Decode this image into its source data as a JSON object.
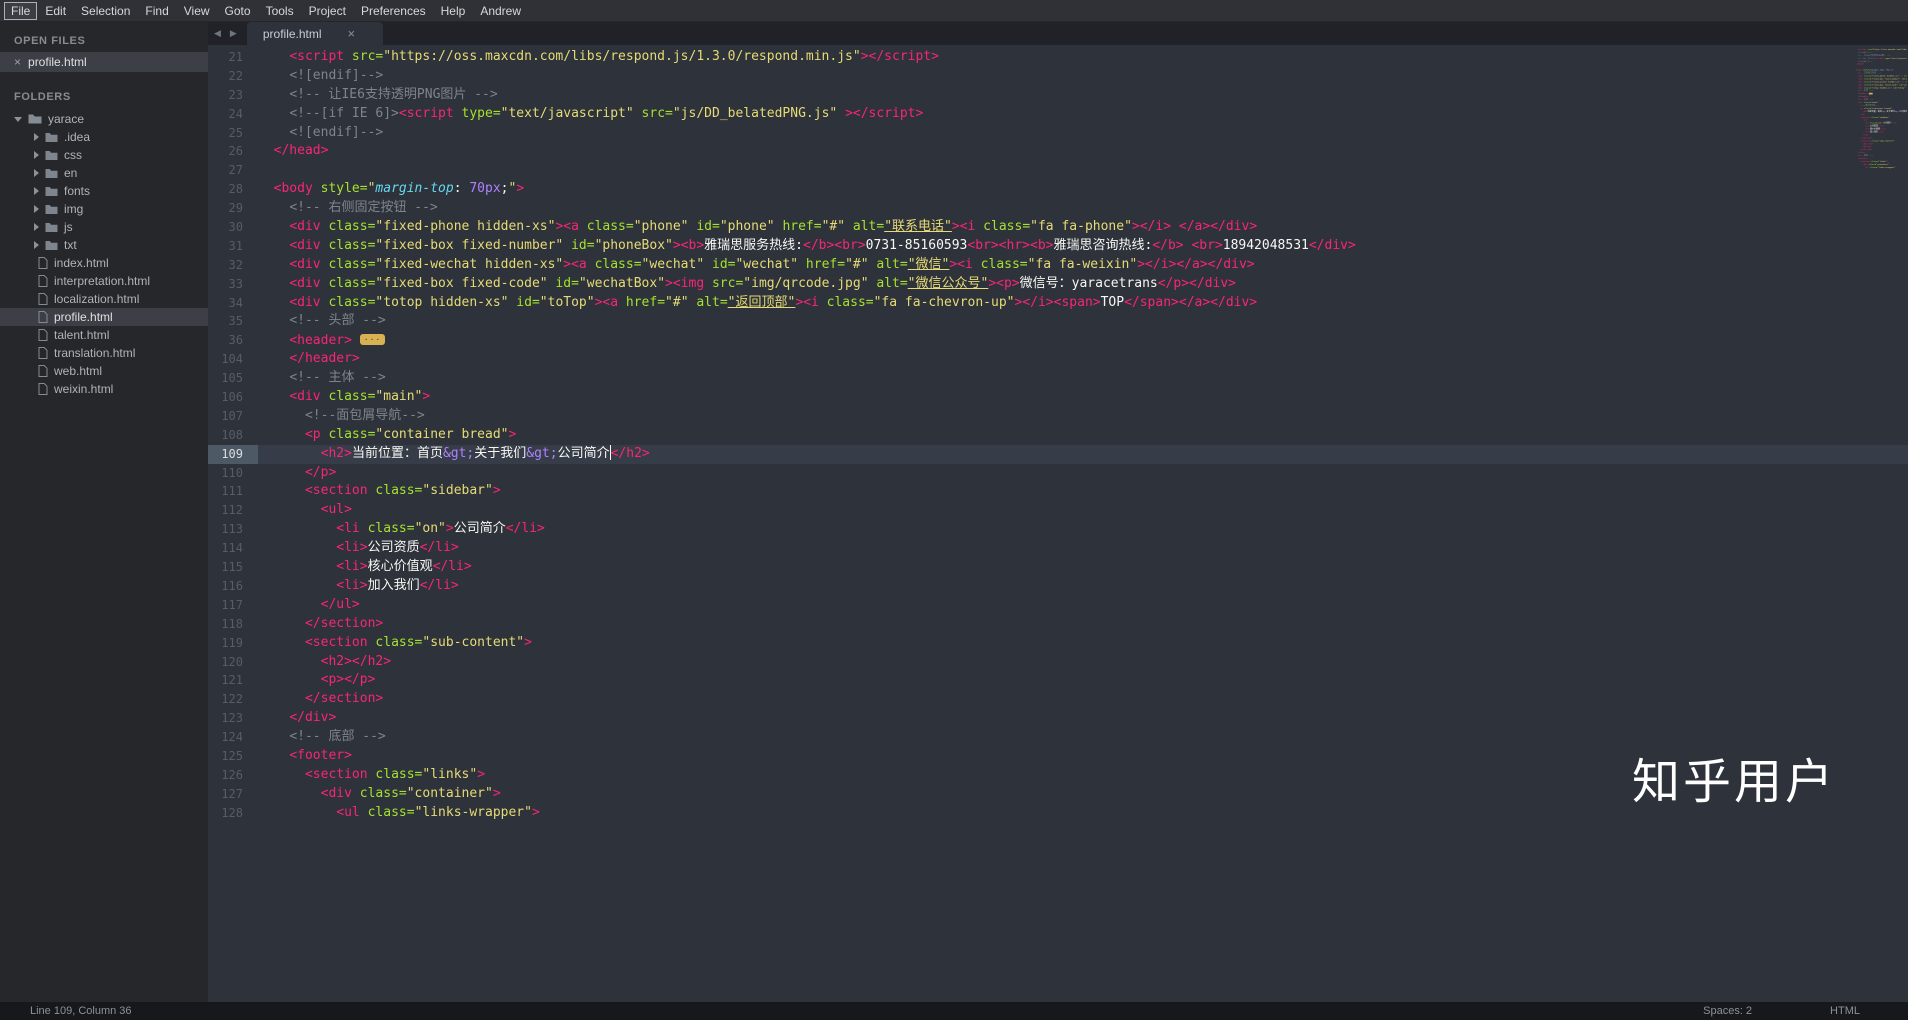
{
  "menu": {
    "items": [
      "File",
      "Edit",
      "Selection",
      "Find",
      "View",
      "Goto",
      "Tools",
      "Project",
      "Preferences",
      "Help",
      "Andrew"
    ],
    "active_item": "File"
  },
  "sidebar": {
    "open_files_label": "OPEN FILES",
    "close_icon": "×",
    "open_files": [
      {
        "name": "profile.html",
        "selected": true
      }
    ],
    "folders_label": "FOLDERS",
    "tree": {
      "root": "yarace",
      "folders": [
        ".idea",
        "css",
        "en",
        "fonts",
        "img",
        "js",
        "txt"
      ],
      "files": [
        "index.html",
        "interpretation.html",
        "localization.html",
        "profile.html",
        "talent.html",
        "translation.html",
        "web.html",
        "weixin.html"
      ],
      "selected_file": "profile.html"
    }
  },
  "tabbar": {
    "back_icon": "◀",
    "forward_icon": "▶",
    "tabs": [
      {
        "title": "profile.html",
        "active": true,
        "close_icon": "×"
      }
    ]
  },
  "editor": {
    "cursor_line": 109,
    "lines": [
      {
        "n": 21,
        "t": [
          [
            "w",
            "    "
          ],
          [
            "t",
            "<script"
          ],
          [
            "a",
            " src="
          ],
          [
            "s",
            "\"https://oss.maxcdn.com/libs/respond.js/1.3.0/respond.min.js\""
          ],
          [
            "t",
            "></script>"
          ]
        ]
      },
      {
        "n": 22,
        "t": [
          [
            "w",
            "    "
          ],
          [
            "c",
            "<![endif]-->"
          ]
        ]
      },
      {
        "n": 23,
        "t": [
          [
            "w",
            "    "
          ],
          [
            "c",
            "<!-- 让IE6支持透明PNG图片 -->"
          ]
        ]
      },
      {
        "n": 24,
        "t": [
          [
            "w",
            "    "
          ],
          [
            "c",
            "<!--[if IE 6]>"
          ],
          [
            "t",
            "<script"
          ],
          [
            "a",
            " type="
          ],
          [
            "s",
            "\"text/javascript\""
          ],
          [
            "a",
            " src="
          ],
          [
            "s",
            "\"js/DD_belatedPNG.js\""
          ],
          [
            "w",
            " "
          ],
          [
            "t",
            "></script>"
          ]
        ]
      },
      {
        "n": 25,
        "t": [
          [
            "w",
            "    "
          ],
          [
            "c",
            "<![endif]-->"
          ]
        ]
      },
      {
        "n": 26,
        "t": [
          [
            "w",
            "  "
          ],
          [
            "t",
            "</head>"
          ]
        ]
      },
      {
        "n": 27,
        "t": []
      },
      {
        "n": 28,
        "t": [
          [
            "w",
            "  "
          ],
          [
            "t",
            "<body"
          ],
          [
            "a",
            " style="
          ],
          [
            "s",
            "\""
          ],
          [
            "i",
            "margin-top"
          ],
          [
            "w",
            ": "
          ],
          [
            "p",
            "70px"
          ],
          [
            "w",
            ";"
          ],
          [
            "s",
            "\""
          ],
          [
            "t",
            ">"
          ]
        ]
      },
      {
        "n": 29,
        "t": [
          [
            "w",
            "    "
          ],
          [
            "c",
            "<!-- 右侧固定按钮 -->"
          ]
        ]
      },
      {
        "n": 30,
        "t": [
          [
            "w",
            "    "
          ],
          [
            "t",
            "<div"
          ],
          [
            "a",
            " class="
          ],
          [
            "s",
            "\"fixed-phone hidden-xs\""
          ],
          [
            "t",
            "><a"
          ],
          [
            "a",
            " class="
          ],
          [
            "s",
            "\"phone\""
          ],
          [
            "a",
            " id="
          ],
          [
            "s",
            "\"phone\""
          ],
          [
            "a",
            " href="
          ],
          [
            "s",
            "\"#\""
          ],
          [
            "a",
            " alt="
          ],
          [
            "u",
            "\"联系电话\""
          ],
          [
            "t",
            "><i"
          ],
          [
            "a",
            " class="
          ],
          [
            "s",
            "\"fa fa-phone\""
          ],
          [
            "t",
            "></i>"
          ],
          [
            "w",
            " "
          ],
          [
            "t",
            "</a></div>"
          ]
        ]
      },
      {
        "n": 31,
        "t": [
          [
            "w",
            "    "
          ],
          [
            "t",
            "<div"
          ],
          [
            "a",
            " class="
          ],
          [
            "s",
            "\"fixed-box fixed-number\""
          ],
          [
            "a",
            " id="
          ],
          [
            "s",
            "\"phoneBox\""
          ],
          [
            "t",
            "><b>"
          ],
          [
            "w",
            "雅瑞思服务热线:"
          ],
          [
            "t",
            "</b><br>"
          ],
          [
            "w",
            "0731-85160593"
          ],
          [
            "t",
            "<br><hr><b>"
          ],
          [
            "w",
            "雅瑞思咨询热线:"
          ],
          [
            "t",
            "</b>"
          ],
          [
            "w",
            " "
          ],
          [
            "t",
            "<br>"
          ],
          [
            "w",
            "18942048531"
          ],
          [
            "t",
            "</div>"
          ]
        ]
      },
      {
        "n": 32,
        "t": [
          [
            "w",
            "    "
          ],
          [
            "t",
            "<div"
          ],
          [
            "a",
            " class="
          ],
          [
            "s",
            "\"fixed-wechat hidden-xs\""
          ],
          [
            "t",
            "><a"
          ],
          [
            "a",
            " class="
          ],
          [
            "s",
            "\"wechat\""
          ],
          [
            "a",
            " id="
          ],
          [
            "s",
            "\"wechat\""
          ],
          [
            "a",
            " href="
          ],
          [
            "s",
            "\"#\""
          ],
          [
            "a",
            " alt="
          ],
          [
            "u",
            "\"微信\""
          ],
          [
            "t",
            "><i"
          ],
          [
            "a",
            " class="
          ],
          [
            "s",
            "\"fa fa-weixin\""
          ],
          [
            "t",
            "></i></a></div>"
          ]
        ]
      },
      {
        "n": 33,
        "t": [
          [
            "w",
            "    "
          ],
          [
            "t",
            "<div"
          ],
          [
            "a",
            " class="
          ],
          [
            "s",
            "\"fixed-box fixed-code\""
          ],
          [
            "a",
            " id="
          ],
          [
            "s",
            "\"wechatBox\""
          ],
          [
            "t",
            "><img"
          ],
          [
            "a",
            " src="
          ],
          [
            "s",
            "\"img/qrcode.jpg\""
          ],
          [
            "a",
            " alt="
          ],
          [
            "u",
            "\"微信公众号\""
          ],
          [
            "t",
            "><p>"
          ],
          [
            "w",
            "微信号：yaracetrans"
          ],
          [
            "t",
            "</p></div>"
          ]
        ]
      },
      {
        "n": 34,
        "t": [
          [
            "w",
            "    "
          ],
          [
            "t",
            "<div"
          ],
          [
            "a",
            " class="
          ],
          [
            "s",
            "\"totop hidden-xs\""
          ],
          [
            "a",
            " id="
          ],
          [
            "s",
            "\"toTop\""
          ],
          [
            "t",
            "><a"
          ],
          [
            "a",
            " href="
          ],
          [
            "s",
            "\"#\""
          ],
          [
            "a",
            " alt="
          ],
          [
            "u",
            "\"返回顶部\""
          ],
          [
            "t",
            "><i"
          ],
          [
            "a",
            " class="
          ],
          [
            "s",
            "\"fa fa-chevron-up\""
          ],
          [
            "t",
            "></i><span>"
          ],
          [
            "w",
            "TOP"
          ],
          [
            "t",
            "</span></a></div>"
          ]
        ]
      },
      {
        "n": 35,
        "t": [
          [
            "w",
            "    "
          ],
          [
            "c",
            "<!-- 头部 -->"
          ]
        ]
      },
      {
        "n": 36,
        "t": [
          [
            "w",
            "    "
          ],
          [
            "t",
            "<header>"
          ],
          [
            "w",
            " "
          ],
          [
            "f",
            "···"
          ]
        ]
      },
      {
        "n": 104,
        "t": [
          [
            "w",
            "    "
          ],
          [
            "t",
            "</header>"
          ]
        ]
      },
      {
        "n": 105,
        "t": [
          [
            "w",
            "    "
          ],
          [
            "c",
            "<!-- 主体 -->"
          ]
        ]
      },
      {
        "n": 106,
        "t": [
          [
            "w",
            "    "
          ],
          [
            "t",
            "<div"
          ],
          [
            "a",
            " class="
          ],
          [
            "s",
            "\"main\""
          ],
          [
            "t",
            ">"
          ]
        ]
      },
      {
        "n": 107,
        "t": [
          [
            "w",
            "      "
          ],
          [
            "c",
            "<!--面包屑导航-->"
          ]
        ]
      },
      {
        "n": 108,
        "t": [
          [
            "w",
            "      "
          ],
          [
            "t",
            "<p"
          ],
          [
            "a",
            " class="
          ],
          [
            "s",
            "\"container bread\""
          ],
          [
            "t",
            ">"
          ]
        ]
      },
      {
        "n": 109,
        "t": [
          [
            "w",
            "        "
          ],
          [
            "t",
            "<h2>"
          ],
          [
            "w",
            "当前位置：首页"
          ],
          [
            "p",
            "&gt;"
          ],
          [
            "w",
            "关于我们"
          ],
          [
            "p",
            "&gt;"
          ],
          [
            "w",
            "公司简介"
          ],
          [
            "k",
            ""
          ],
          [
            "t",
            "</h2>"
          ]
        ]
      },
      {
        "n": 110,
        "t": [
          [
            "w",
            "      "
          ],
          [
            "t",
            "</p>"
          ]
        ]
      },
      {
        "n": 111,
        "t": [
          [
            "w",
            "      "
          ],
          [
            "t",
            "<section"
          ],
          [
            "a",
            " class="
          ],
          [
            "s",
            "\"sidebar\""
          ],
          [
            "t",
            ">"
          ]
        ]
      },
      {
        "n": 112,
        "t": [
          [
            "w",
            "        "
          ],
          [
            "t",
            "<ul>"
          ]
        ]
      },
      {
        "n": 113,
        "t": [
          [
            "w",
            "          "
          ],
          [
            "t",
            "<li"
          ],
          [
            "a",
            " class="
          ],
          [
            "s",
            "\"on\""
          ],
          [
            "t",
            ">"
          ],
          [
            "w",
            "公司简介"
          ],
          [
            "t",
            "</li>"
          ]
        ]
      },
      {
        "n": 114,
        "t": [
          [
            "w",
            "          "
          ],
          [
            "t",
            "<li>"
          ],
          [
            "w",
            "公司资质"
          ],
          [
            "t",
            "</li>"
          ]
        ]
      },
      {
        "n": 115,
        "t": [
          [
            "w",
            "          "
          ],
          [
            "t",
            "<li>"
          ],
          [
            "w",
            "核心价值观"
          ],
          [
            "t",
            "</li>"
          ]
        ]
      },
      {
        "n": 116,
        "t": [
          [
            "w",
            "          "
          ],
          [
            "t",
            "<li>"
          ],
          [
            "w",
            "加入我们"
          ],
          [
            "t",
            "</li>"
          ]
        ]
      },
      {
        "n": 117,
        "t": [
          [
            "w",
            "        "
          ],
          [
            "t",
            "</ul>"
          ]
        ]
      },
      {
        "n": 118,
        "t": [
          [
            "w",
            "      "
          ],
          [
            "t",
            "</section>"
          ]
        ]
      },
      {
        "n": 119,
        "t": [
          [
            "w",
            "      "
          ],
          [
            "t",
            "<section"
          ],
          [
            "a",
            " class="
          ],
          [
            "s",
            "\"sub-content\""
          ],
          [
            "t",
            ">"
          ]
        ]
      },
      {
        "n": 120,
        "t": [
          [
            "w",
            "        "
          ],
          [
            "t",
            "<h2></h2>"
          ]
        ]
      },
      {
        "n": 121,
        "t": [
          [
            "w",
            "        "
          ],
          [
            "t",
            "<p></p>"
          ]
        ]
      },
      {
        "n": 122,
        "t": [
          [
            "w",
            "      "
          ],
          [
            "t",
            "</section>"
          ]
        ]
      },
      {
        "n": 123,
        "t": [
          [
            "w",
            "    "
          ],
          [
            "t",
            "</div>"
          ]
        ]
      },
      {
        "n": 124,
        "t": [
          [
            "w",
            "    "
          ],
          [
            "c",
            "<!-- 底部 -->"
          ]
        ]
      },
      {
        "n": 125,
        "t": [
          [
            "w",
            "    "
          ],
          [
            "t",
            "<footer>"
          ]
        ]
      },
      {
        "n": 126,
        "t": [
          [
            "w",
            "      "
          ],
          [
            "t",
            "<section"
          ],
          [
            "a",
            " class="
          ],
          [
            "s",
            "\"links\""
          ],
          [
            "t",
            ">"
          ]
        ]
      },
      {
        "n": 127,
        "t": [
          [
            "w",
            "        "
          ],
          [
            "t",
            "<div"
          ],
          [
            "a",
            " class="
          ],
          [
            "s",
            "\"container\""
          ],
          [
            "t",
            ">"
          ]
        ]
      },
      {
        "n": 128,
        "t": [
          [
            "w",
            "          "
          ],
          [
            "t",
            "<ul"
          ],
          [
            "a",
            " class="
          ],
          [
            "s",
            "\"links-wrapper\""
          ],
          [
            "t",
            ">"
          ]
        ]
      }
    ]
  },
  "statusbar": {
    "position": "Line 109, Column 36",
    "spaces": "Spaces: 2",
    "syntax": "HTML"
  },
  "watermark": "知乎用户",
  "colors": {
    "editor_bg": "#2d323b",
    "tag": "#f92672",
    "attr": "#a6e22e",
    "string": "#e6db74",
    "comment": "#7f848c",
    "entity": "#ae81ff",
    "css_property": "#66d9ef",
    "plain_text": "#f8f8f2",
    "fold_marker": "#d8b153",
    "current_line_gutter": "#4d5a66"
  }
}
